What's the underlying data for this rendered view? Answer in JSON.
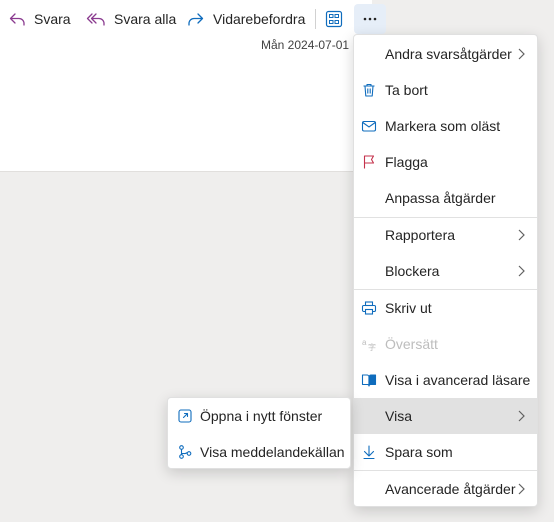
{
  "toolbar": {
    "reply_label": "Svara",
    "reply_all_label": "Svara alla",
    "forward_label": "Vidarebefordra"
  },
  "message": {
    "date": "Mån 2024-07-01"
  },
  "menu": {
    "items": [
      {
        "label": "Andra svarsåtgärder",
        "icon": "none",
        "submenu": true
      },
      {
        "label": "Ta bort",
        "icon": "trash-icon"
      },
      {
        "label": "Markera som oläst",
        "icon": "envelope-icon"
      },
      {
        "label": "Flagga",
        "icon": "flag-icon"
      },
      {
        "label": "Anpassa åtgärder",
        "icon": "none"
      },
      {
        "label": "Rapportera",
        "icon": "none",
        "submenu": true
      },
      {
        "label": "Blockera",
        "icon": "none",
        "submenu": true
      },
      {
        "label": "Skriv ut",
        "icon": "printer-icon"
      },
      {
        "label": "Översätt",
        "icon": "translate-icon",
        "disabled": true
      },
      {
        "label": "Visa i avancerad läsare",
        "icon": "immersive-reader-icon"
      },
      {
        "label": "Visa",
        "icon": "none",
        "submenu": true,
        "active": true
      },
      {
        "label": "Spara som",
        "icon": "download-icon"
      },
      {
        "label": "Avancerade åtgärder",
        "icon": "none",
        "submenu": true
      }
    ]
  },
  "submenu": {
    "items": [
      {
        "label": "Öppna i nytt fönster",
        "icon": "open-in-new-window-icon"
      },
      {
        "label": "Visa meddelandekällan",
        "icon": "view-source-icon"
      }
    ]
  },
  "colors": {
    "accent": "#0f6cbd",
    "reply_icon": "#8a3a8f",
    "flag_icon": "#c4314b",
    "background": "#efeeed"
  }
}
